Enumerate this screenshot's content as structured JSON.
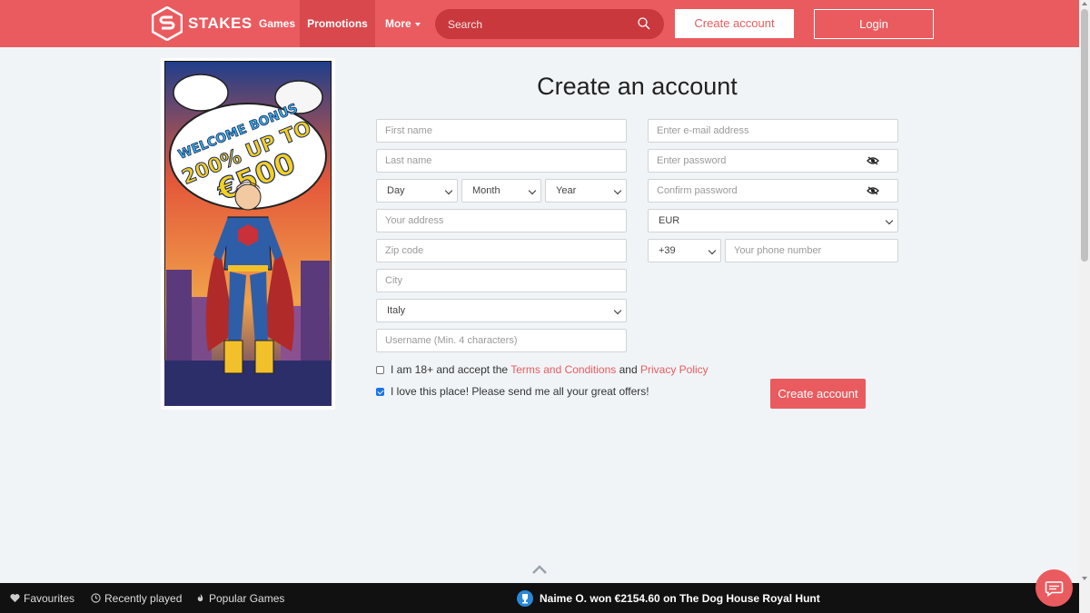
{
  "brand": {
    "name": "STAKES",
    "accent": "#ea5b5f"
  },
  "nav": {
    "games": "Games",
    "promotions": "Promotions",
    "more": "More"
  },
  "search": {
    "placeholder": "Search"
  },
  "header": {
    "create_account": "Create account",
    "login": "Login"
  },
  "promo": {
    "line1": "WELCOME BONUS",
    "line2": "200% UP TO",
    "line3": "€500"
  },
  "form": {
    "title": "Create an account",
    "first_name": "First name",
    "last_name": "Last name",
    "day": "Day",
    "month": "Month",
    "year": "Year",
    "address": "Your address",
    "zip": "Zip code",
    "city": "City",
    "country": "Italy",
    "username": "Username (Min. 4 characters)",
    "email": "Enter e-mail address",
    "password": "Enter password",
    "confirm_password": "Confirm password",
    "currency": "EUR",
    "phone_prefix": "+39",
    "phone": "Your phone number",
    "terms_prefix": "I am 18+ and accept the ",
    "terms_link": "Terms and Conditions",
    "terms_and": " and ",
    "privacy_link": "Privacy Policy",
    "offers": "I love this place! Please send me all your great offers!",
    "terms_checked": false,
    "offers_checked": true,
    "submit": "Create account"
  },
  "bottom": {
    "favourites": "Favourites",
    "recently_played": "Recently played",
    "popular_games": "Popular Games",
    "winner": "Naime O. won €2154.60 on The Dog House Royal Hunt"
  }
}
